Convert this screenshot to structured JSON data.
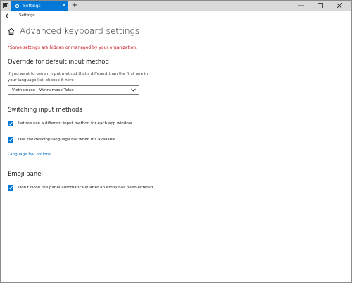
{
  "window": {
    "tab_title": "Settings",
    "nav_title": "Settings"
  },
  "page": {
    "title": "Advanced keyboard settings",
    "managed_notice": "*Some settings are hidden or managed by your organization."
  },
  "override": {
    "title": "Override for default input method",
    "description": "If you want to use an input method that's different than the first one in your language list, choose it here",
    "selected": "Vietnamese - Vietnamese Telex"
  },
  "switching": {
    "title": "Switching input methods",
    "options": [
      {
        "label": "Let me use a different input method for each app window",
        "checked": true
      },
      {
        "label": "Use the desktop language bar when it's available",
        "checked": true
      }
    ],
    "link": "Language bar options"
  },
  "emoji": {
    "title": "Emoji panel",
    "options": [
      {
        "label": "Don't close the panel automatically after an emoji has been entered",
        "checked": true
      }
    ]
  },
  "colors": {
    "accent": "#0078d7",
    "warning": "#c50f1f",
    "link": "#0067c0"
  },
  "icons": [
    "app-icon",
    "gear-icon",
    "close-icon",
    "plus-icon",
    "minimize-icon",
    "maximize-icon",
    "back-arrow-icon",
    "home-icon",
    "chevron-down-icon",
    "checkmark-icon"
  ]
}
